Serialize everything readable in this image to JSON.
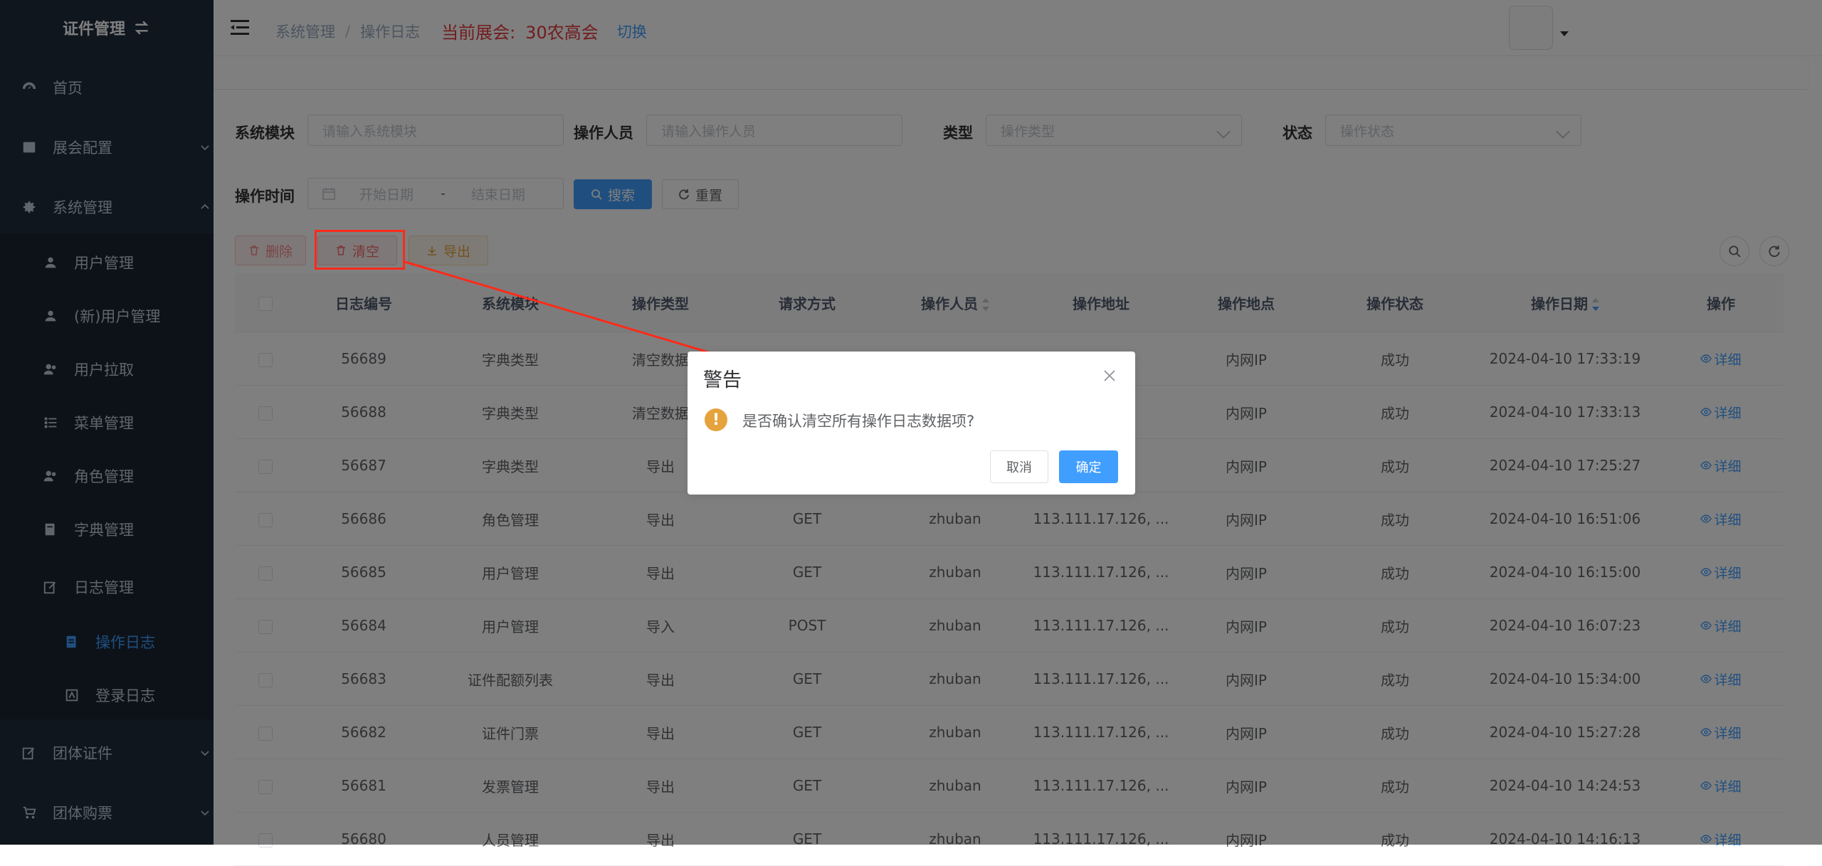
{
  "sidebar": {
    "title": "证件管理",
    "items": [
      {
        "label": "首页"
      },
      {
        "label": "展会配置"
      },
      {
        "label": "系统管理"
      },
      {
        "label": "用户管理"
      },
      {
        "label": "(新)用户管理"
      },
      {
        "label": "用户拉取"
      },
      {
        "label": "菜单管理"
      },
      {
        "label": "角色管理"
      },
      {
        "label": "字典管理"
      },
      {
        "label": "日志管理"
      },
      {
        "label": "操作日志"
      },
      {
        "label": "登录日志"
      },
      {
        "label": "团体证件"
      },
      {
        "label": "团体购票"
      }
    ]
  },
  "header": {
    "breadcrumb": [
      "系统管理",
      "操作日志"
    ],
    "breadcrumb_sep": "/",
    "current_exhibit_label": "当前展会:",
    "current_exhibit_value": "30农高会",
    "switch_label": "切换"
  },
  "search": {
    "module_label": "系统模块",
    "module_placeholder": "请输入系统模块",
    "operator_label": "操作人员",
    "operator_placeholder": "请输入操作人员",
    "type_label": "类型",
    "type_placeholder": "操作类型",
    "status_label": "状态",
    "status_placeholder": "操作状态",
    "time_label": "操作时间",
    "start_placeholder": "开始日期",
    "range_sep": "-",
    "end_placeholder": "结束日期",
    "search_button": "搜索",
    "reset_button": "重置"
  },
  "toolbar": {
    "delete_button": "删除",
    "clear_button": "清空",
    "export_button": "导出"
  },
  "table": {
    "columns": [
      "日志编号",
      "系统模块",
      "操作类型",
      "请求方式",
      "操作人员",
      "操作地址",
      "操作地点",
      "操作状态",
      "操作日期",
      "操作"
    ],
    "rows": [
      {
        "id": "56689",
        "module": "字典类型",
        "type": "清空数据",
        "method": "",
        "operator": "",
        "addr": "",
        "loc": "内网IP",
        "status": "成功",
        "date": "2024-04-10 17:33:19",
        "action": "详细"
      },
      {
        "id": "56688",
        "module": "字典类型",
        "type": "清空数据",
        "method": "",
        "operator": "",
        "addr": "",
        "loc": "内网IP",
        "status": "成功",
        "date": "2024-04-10 17:33:13",
        "action": "详细"
      },
      {
        "id": "56687",
        "module": "字典类型",
        "type": "导出",
        "method": "",
        "operator": "",
        "addr": "",
        "loc": "内网IP",
        "status": "成功",
        "date": "2024-04-10 17:25:27",
        "action": "详细"
      },
      {
        "id": "56686",
        "module": "角色管理",
        "type": "导出",
        "method": "GET",
        "operator": "zhuban",
        "addr": "113.111.17.126, ...",
        "loc": "内网IP",
        "status": "成功",
        "date": "2024-04-10 16:51:06",
        "action": "详细"
      },
      {
        "id": "56685",
        "module": "用户管理",
        "type": "导出",
        "method": "GET",
        "operator": "zhuban",
        "addr": "113.111.17.126, ...",
        "loc": "内网IP",
        "status": "成功",
        "date": "2024-04-10 16:15:00",
        "action": "详细"
      },
      {
        "id": "56684",
        "module": "用户管理",
        "type": "导入",
        "method": "POST",
        "operator": "zhuban",
        "addr": "113.111.17.126, ...",
        "loc": "内网IP",
        "status": "成功",
        "date": "2024-04-10 16:07:23",
        "action": "详细"
      },
      {
        "id": "56683",
        "module": "证件配额列表",
        "type": "导出",
        "method": "GET",
        "operator": "zhuban",
        "addr": "113.111.17.126, ...",
        "loc": "内网IP",
        "status": "成功",
        "date": "2024-04-10 15:34:00",
        "action": "详细"
      },
      {
        "id": "56682",
        "module": "证件门票",
        "type": "导出",
        "method": "GET",
        "operator": "zhuban",
        "addr": "113.111.17.126, ...",
        "loc": "内网IP",
        "status": "成功",
        "date": "2024-04-10 15:27:28",
        "action": "详细"
      },
      {
        "id": "56681",
        "module": "发票管理",
        "type": "导出",
        "method": "GET",
        "operator": "zhuban",
        "addr": "113.111.17.126, ...",
        "loc": "内网IP",
        "status": "成功",
        "date": "2024-04-10 14:24:53",
        "action": "详细"
      },
      {
        "id": "56680",
        "module": "人员管理",
        "type": "导出",
        "method": "GET",
        "operator": "zhuban",
        "addr": "113.111.17.126, ...",
        "loc": "内网IP",
        "status": "成功",
        "date": "2024-04-10 14:16:13",
        "action": "详细"
      }
    ]
  },
  "dialog": {
    "title": "警告",
    "icon": "!",
    "message": "是否确认清空所有操作日志数据项?",
    "cancel": "取消",
    "confirm": "确定"
  },
  "colors": {
    "sidebar_bg": "#1f2d3d",
    "primary": "#409eff",
    "warning": "#e6a23c",
    "annotation_red": "#ff2a1a"
  }
}
